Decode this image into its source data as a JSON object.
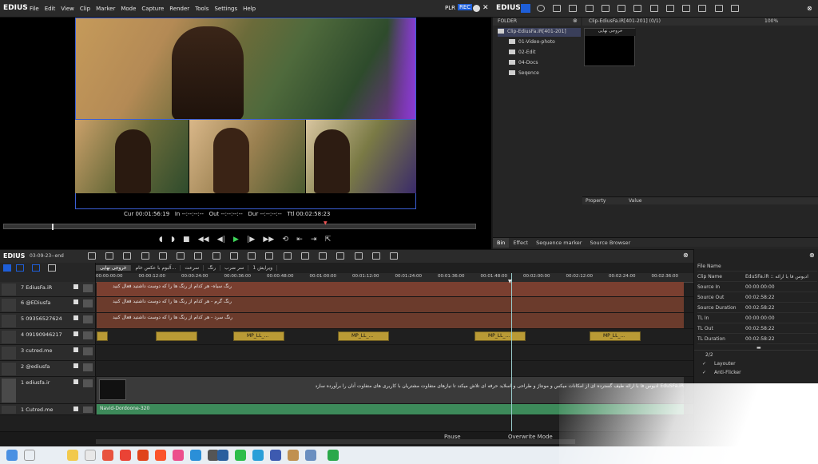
{
  "app": {
    "logo": "EDIUS",
    "plr_label": "PLR",
    "rec_label": "REC"
  },
  "menu": [
    "File",
    "Edit",
    "View",
    "Clip",
    "Marker",
    "Mode",
    "Capture",
    "Render",
    "Tools",
    "Settings",
    "Help"
  ],
  "player": {
    "timecodes": {
      "cur_label": "Cur",
      "cur": "00:01:56:19",
      "in_label": "In",
      "in": "--:--:--:--",
      "out_label": "Out",
      "out": "--:--:--:--",
      "dur_label": "Dur",
      "dur": "--:--:--:--",
      "ttl_label": "Ttl",
      "ttl": "00:02:58:23"
    }
  },
  "bin": {
    "logo": "EDIUS",
    "folder_header": "FOLDER",
    "path": "Clip-EdiusFa.iR[401-201] (0/1)",
    "zoom": "100%",
    "tree": [
      {
        "label": "Clip-EdiusFa.iR[401-201]",
        "indent": 0
      },
      {
        "label": "01-Video-photo",
        "indent": 1
      },
      {
        "label": "02-Edit",
        "indent": 1
      },
      {
        "label": "04-Docs",
        "indent": 1
      },
      {
        "label": "Seqence",
        "indent": 1
      }
    ],
    "clip_title": "خروجی نهایی",
    "property_header": "Property",
    "value_header": "Value",
    "tabs": [
      "Bin",
      "Effect",
      "Sequence marker",
      "Source Browser"
    ]
  },
  "timeline": {
    "logo": "EDIUS",
    "project": "03-09-23--end",
    "sequence_tabs": [
      "خروجی نهایی",
      "آلبوم با عکس خام...",
      "سرعت",
      "رنگ",
      "سر ضرب",
      "ویرایش 1"
    ],
    "ruler": [
      "00:00:00:00",
      "00:00:12:00",
      "00:00:24:00",
      "00:00:36:00",
      "00:00:48:00",
      "00:01:00:00",
      "00:01:12:00",
      "00:01:24:00",
      "00:01:36:00",
      "00:01:48:00",
      "00:02:00:00",
      "00:02:12:00",
      "00:02:24:00",
      "00:02:36:00"
    ],
    "tracks": [
      {
        "name": "7 EdiusFa.iR",
        "h": 19,
        "clip": "رنگ سیاه- هر کدام از رنگ ها را که دوست داشتید فعال کنید",
        "color": "#7a3f30"
      },
      {
        "name": "6 @EDiusfa",
        "h": 20,
        "clip": "رنگ گرم - هر کدام از رنگ ها را که دوست داشتید فعال کنید",
        "color": "#6b3b2c"
      },
      {
        "name": "5 09356527624",
        "h": 20,
        "clip": "رنگ سرد - هر کدام از رنگ ها را که دوست داشتید فعال کنید",
        "color": "#6b3b2c"
      },
      {
        "name": "4 09190946217",
        "h": 20,
        "clip": "",
        "color": "#b99a35"
      },
      {
        "name": "3 cutred.me",
        "h": 20,
        "clip": "",
        "color": ""
      },
      {
        "name": "2 @ediusfa",
        "h": 20,
        "clip": "",
        "color": ""
      },
      {
        "name": "1 ediusfa.ir",
        "h": 34,
        "clip": "EduSFa.iR ادیوس فا با ارائه طیف گسترده ای از امکانات میکس و مونتاژ و طراحی و اسلاید حرفه ای تلاش میکند تا نیازهای متفاوت مشتریان با کاربری های متفاوت آنان را برآورده سازد",
        "color": "#3a3a3a"
      },
      {
        "name": "1 Cutred.me",
        "h": 14,
        "clip": "Navid-Dordoone-320",
        "color": "#3d8a5a"
      }
    ],
    "mp_clips": [
      "MP_LL_...",
      "MP_LL_...",
      "MP_LL_...",
      "MP_LL_..."
    ],
    "status": {
      "pause": "Pause",
      "mode": "Overwrite Mode"
    }
  },
  "info": {
    "rows": [
      {
        "k": "File Name",
        "v": ""
      },
      {
        "k": "Clip Name",
        "v": "EduSFa.iR :: ادیوس فا با ارائه"
      },
      {
        "k": "Source In",
        "v": "00:00:00:00"
      },
      {
        "k": "Source Out",
        "v": "00:02:58:22"
      },
      {
        "k": "Source Duration",
        "v": "00:02:58:22"
      },
      {
        "k": "TL In",
        "v": "00:00:00:00"
      },
      {
        "k": "TL Out",
        "v": "00:02:58:22"
      },
      {
        "k": "TL Duration",
        "v": "00:02:58:22"
      }
    ],
    "count": "2/2",
    "effects": [
      "Layouter",
      "Anti-Flicker"
    ]
  }
}
